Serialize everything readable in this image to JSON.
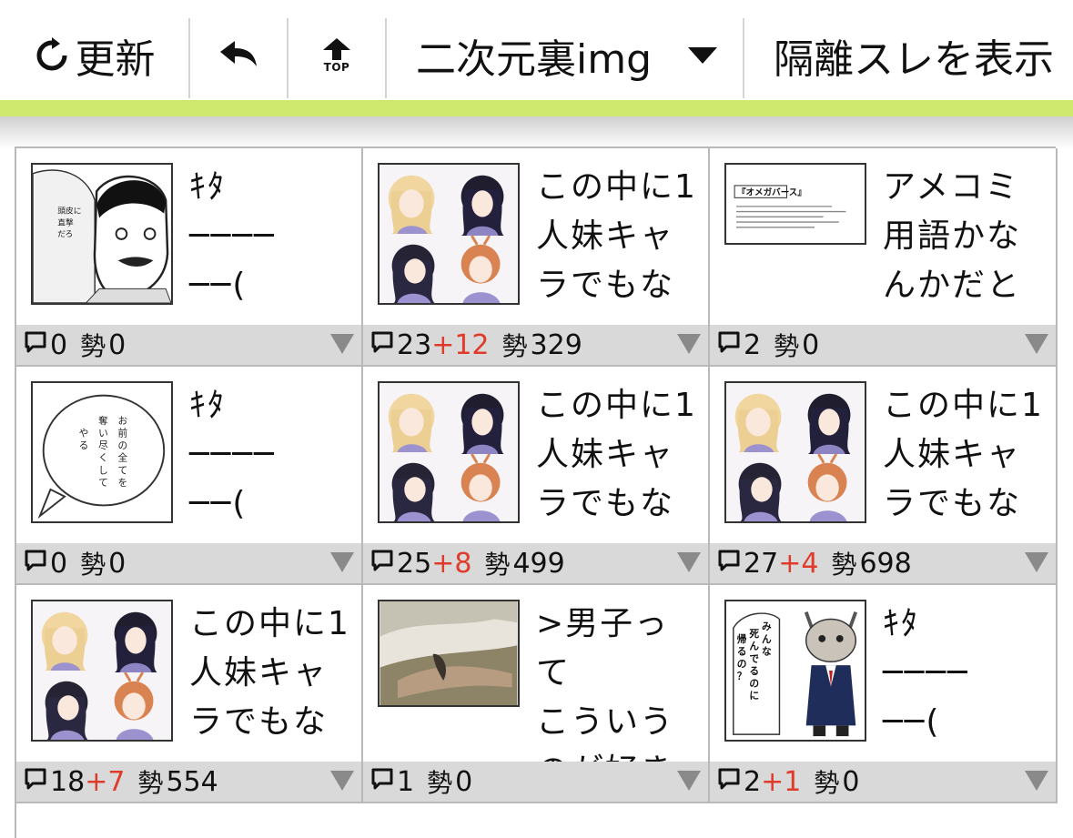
{
  "toolbar": {
    "refresh_label": "更新",
    "top_label": "TOP",
    "board_label": "二次元裏img",
    "isolate_label": "隔離スレを表示"
  },
  "colors": {
    "accent": "#cfe96f",
    "plus": "#e03a2a",
    "footer_bg": "#d9d9d9"
  },
  "ikioi_label": "勢",
  "threads": [
    {
      "title": "ｷﾀ\n────\n──(",
      "thumb": "manga-man",
      "res": "0",
      "plus": "",
      "ikioi": "0"
    },
    {
      "title": "この中に1\n人妹キャ\nラでもな",
      "thumb": "anime-girls",
      "res": "23",
      "plus": "+12",
      "ikioi": "329"
    },
    {
      "title": "アメコミ\n用語かな\nんかだと",
      "thumb": "text-card",
      "res": "2",
      "plus": "",
      "ikioi": "0"
    },
    {
      "title": "ｷﾀ\n────\n──(",
      "thumb": "speech-bubble",
      "res": "0",
      "plus": "",
      "ikioi": "0"
    },
    {
      "title": "この中に1\n人妹キャ\nラでもな",
      "thumb": "anime-girls",
      "res": "25",
      "plus": "+8",
      "ikioi": "499"
    },
    {
      "title": "この中に1\n人妹キャ\nラでもな",
      "thumb": "anime-girls",
      "res": "27",
      "plus": "+4",
      "ikioi": "698"
    },
    {
      "title": "この中に1\n人妹キャ\nラでもな",
      "thumb": "anime-girls",
      "res": "18",
      "plus": "+7",
      "ikioi": "554"
    },
    {
      "title": ">男子って\nこういう\nのが好き",
      "thumb": "photo",
      "res": "1",
      "plus": "",
      "ikioi": "0"
    },
    {
      "title": "ｷﾀ\n────\n──(",
      "thumb": "cat-man",
      "res": "2",
      "plus": "+1",
      "ikioi": "0"
    }
  ]
}
